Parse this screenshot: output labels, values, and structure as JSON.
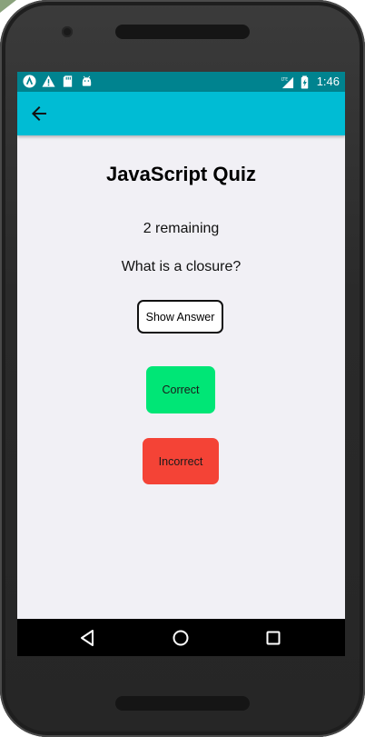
{
  "status_bar": {
    "time": "1:46",
    "left_icons": [
      "app-a-icon",
      "warning-icon",
      "sd-card-icon",
      "android-icon"
    ],
    "right_icons": [
      "signal-lte-icon",
      "battery-charging-icon"
    ]
  },
  "app_bar": {
    "back_icon": "arrow-back-icon",
    "color": "#00bcd4"
  },
  "quiz": {
    "title": "JavaScript Quiz",
    "remaining": "2 remaining",
    "question": "What is a closure?",
    "show_answer_label": "Show Answer",
    "correct_label": "Correct",
    "incorrect_label": "Incorrect"
  },
  "colors": {
    "status_bar": "#00838f",
    "screen_bg": "#f1f0f5",
    "correct": "#00e676",
    "incorrect": "#f44336"
  },
  "nav_bar": {
    "icons": [
      "nav-back-icon",
      "nav-home-icon",
      "nav-recents-icon"
    ]
  }
}
